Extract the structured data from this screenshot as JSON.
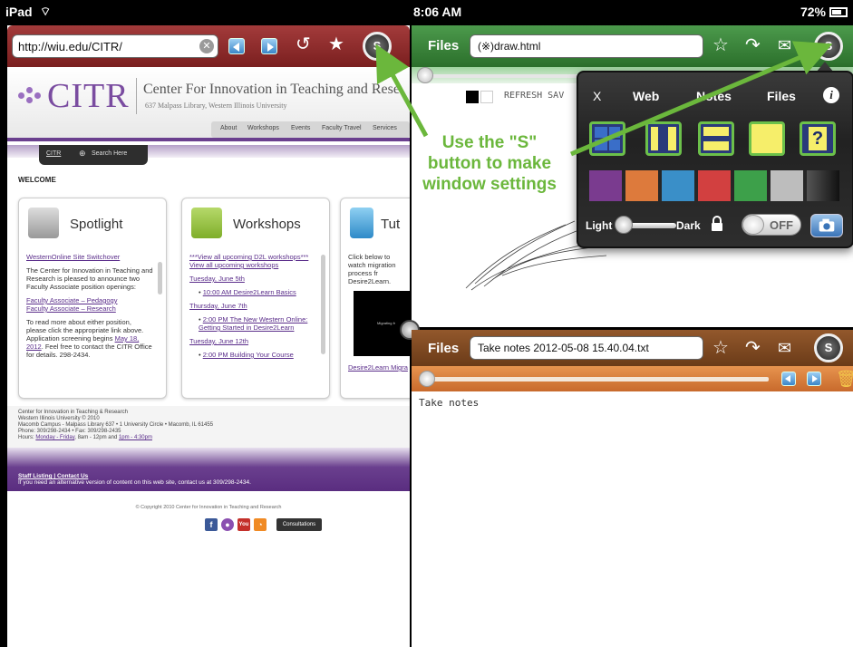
{
  "status_bar": {
    "device": "iPad",
    "time": "8:06 AM",
    "battery": "72%"
  },
  "left_pane": {
    "url": "http://wiu.edu/CITR/",
    "s_button": "S",
    "site": {
      "logo": "CITR",
      "title": "Center For Innovation in Teaching and Rese",
      "address": "637 Malpass Library, Western Illinois University",
      "nav": [
        "About",
        "Workshops",
        "Events",
        "Faculty Travel",
        "Services"
      ],
      "search_tab": {
        "left": "CITR",
        "right": "Search Here"
      },
      "welcome": "WELCOME",
      "spotlight": {
        "title": "Spotlight",
        "link1": "WesternOnline Site Switchover",
        "para1": "The Center for Innovation in Teaching and Research is pleased to announce two Faculty Associate position openings:",
        "link2": "Faculty Associate – Pedagogy",
        "link3": "Faculty Associate – Research",
        "para2_a": "To read more about either position, please click the appropriate link above. Application screening begins",
        "para2_link": "May 18, 2012",
        "para2_b": ". Feel free to contact the CITR Office for details. 298-2434."
      },
      "workshops": {
        "title": "Workshops",
        "link1": "***View all upcoming D2L workshops***",
        "link2": "View all upcoming workshops",
        "date1": "Tuesday, June 5th",
        "item1": "10:00 AM Desire2Learn Basics",
        "date2": "Thursday, June 7th",
        "item2": "2:00 PM The New Western Online: Getting Started in Desire2Learn",
        "date3": "Tuesday, June 12th",
        "item3": "2:00 PM Building Your Course"
      },
      "tutorials": {
        "title": "Tut",
        "text": "Click below to watch migration process fr Desire2Learn.",
        "video_caption": "Migrating fr",
        "link": "Desire2Learn Migra"
      },
      "footer": {
        "line1": "Center for Innovation in Teaching & Research",
        "line2": "Western Illinois University © 2010",
        "line3": "Macomb Campus - Malpass Library 637 • 1 University Circle • Macomb, IL 61455",
        "line4": "Phone: 309/298-2434 • Fax: 309/298-2435",
        "hours_label": "Hours:",
        "hours_link1": "Monday - Friday",
        "hours_mid": ", 8am - 12pm and",
        "hours_link2": "1pm - 4:30pm",
        "staff": "Staff Listing | Contact Us",
        "alt": "If you need an alternative version of content on this web site, contact us at 309/298-2434.",
        "copyright": "© Copyright 2010 Center for Innovation in Teaching and Research",
        "consult": "Consultations"
      }
    }
  },
  "right_top": {
    "files_label": "Files",
    "file_name": "(※)draw.html",
    "s_button": "S",
    "draw_toolbar": "REFRESH  SAV"
  },
  "popup": {
    "close": "X",
    "tabs": [
      "Web",
      "Notes",
      "Files"
    ],
    "info": "i",
    "layout_question": "?",
    "light": "Light",
    "dark": "Dark",
    "toggle": "OFF",
    "swatches": [
      "#7a3b8f",
      "#dd7a3c",
      "#3a8fc8",
      "#d24040",
      "#3da04a",
      "#bdbdbd",
      "#2a2a2a"
    ]
  },
  "right_bottom": {
    "files_label": "Files",
    "file_name": "Take notes 2012-05-08 15.40.04.txt",
    "s_button": "S",
    "content": "Take notes"
  },
  "annotation": {
    "line1": "Use the \"S\"",
    "line2": "button to make",
    "line3": "window settings"
  }
}
